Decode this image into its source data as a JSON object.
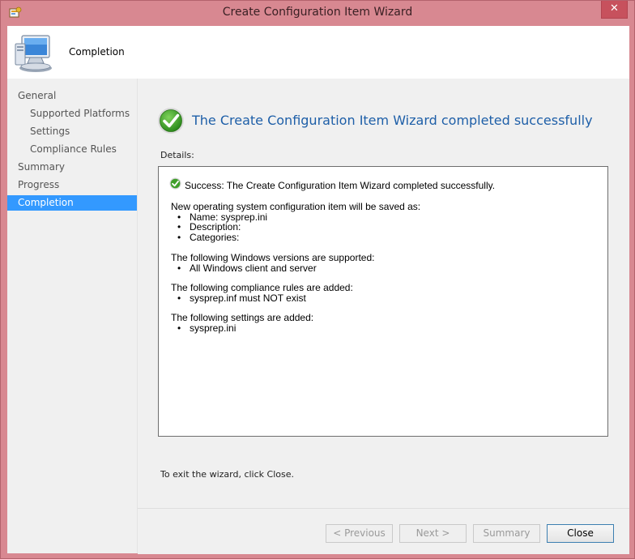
{
  "window": {
    "title": "Create Configuration Item Wizard",
    "close_glyph": "✕"
  },
  "header": {
    "page_title": "Completion",
    "icon": "computer-icon"
  },
  "sidebar": {
    "items": [
      {
        "label": "General",
        "level": 0,
        "active": false
      },
      {
        "label": "Supported Platforms",
        "level": 1,
        "active": false
      },
      {
        "label": "Settings",
        "level": 1,
        "active": false
      },
      {
        "label": "Compliance Rules",
        "level": 1,
        "active": false
      },
      {
        "label": "Summary",
        "level": 0,
        "active": false
      },
      {
        "label": "Progress",
        "level": 0,
        "active": false
      },
      {
        "label": "Completion",
        "level": 0,
        "active": true
      }
    ]
  },
  "content": {
    "headline": "The Create Configuration Item Wizard completed successfully",
    "details_label": "Details:",
    "success_line": "Success: The Create Configuration Item Wizard completed successfully.",
    "sections": [
      {
        "heading": "New operating system configuration item will be saved as:",
        "items": [
          "Name: sysprep.ini",
          "Description:",
          "Categories:"
        ]
      },
      {
        "heading": "The following Windows versions are supported:",
        "items": [
          "All Windows client and server"
        ]
      },
      {
        "heading": "The following compliance rules are added:",
        "items": [
          "sysprep.inf must NOT exist"
        ]
      },
      {
        "heading": "The following settings are added:",
        "items": [
          "sysprep.ini"
        ]
      }
    ],
    "exit_hint": "To exit the wizard, click Close."
  },
  "buttons": {
    "previous": "< Previous",
    "next": "Next >",
    "summary": "Summary",
    "close": "Close"
  },
  "colors": {
    "accent": "#3399ff",
    "headline": "#1e5fa8",
    "frame": "#d88891"
  }
}
